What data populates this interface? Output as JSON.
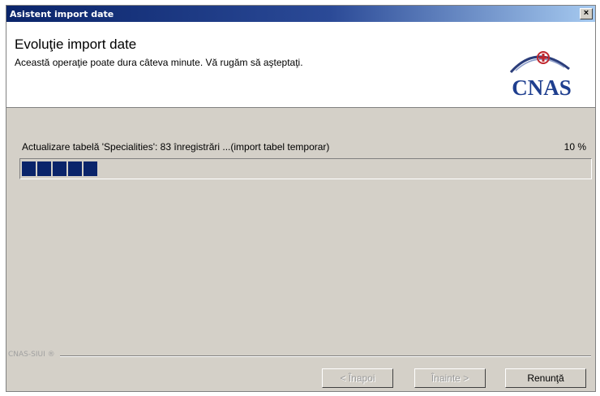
{
  "window": {
    "title": "Asistent import date",
    "close_glyph": "×"
  },
  "header": {
    "title": "Evoluţie import date",
    "subtitle": "Această operaţie poate dura câteva minute. Vă rugăm să aşteptaţi.",
    "logo_text": "CNAS",
    "logo_icon": "cnas-logo-icon"
  },
  "progress": {
    "status": "Actualizare tabelă 'Specialities': 83 înregistrări ...(import tabel temporar)",
    "percent_label": "10 %",
    "value": 0.1
  },
  "footer": {
    "label": "CNAS-SIUI ®"
  },
  "buttons": {
    "back": "< Înapoi",
    "next": "Înainte >",
    "cancel": "Renunţă"
  },
  "colors": {
    "accent": "#0a246a",
    "logo_red": "#c0272d",
    "face": "#d4d0c8"
  }
}
